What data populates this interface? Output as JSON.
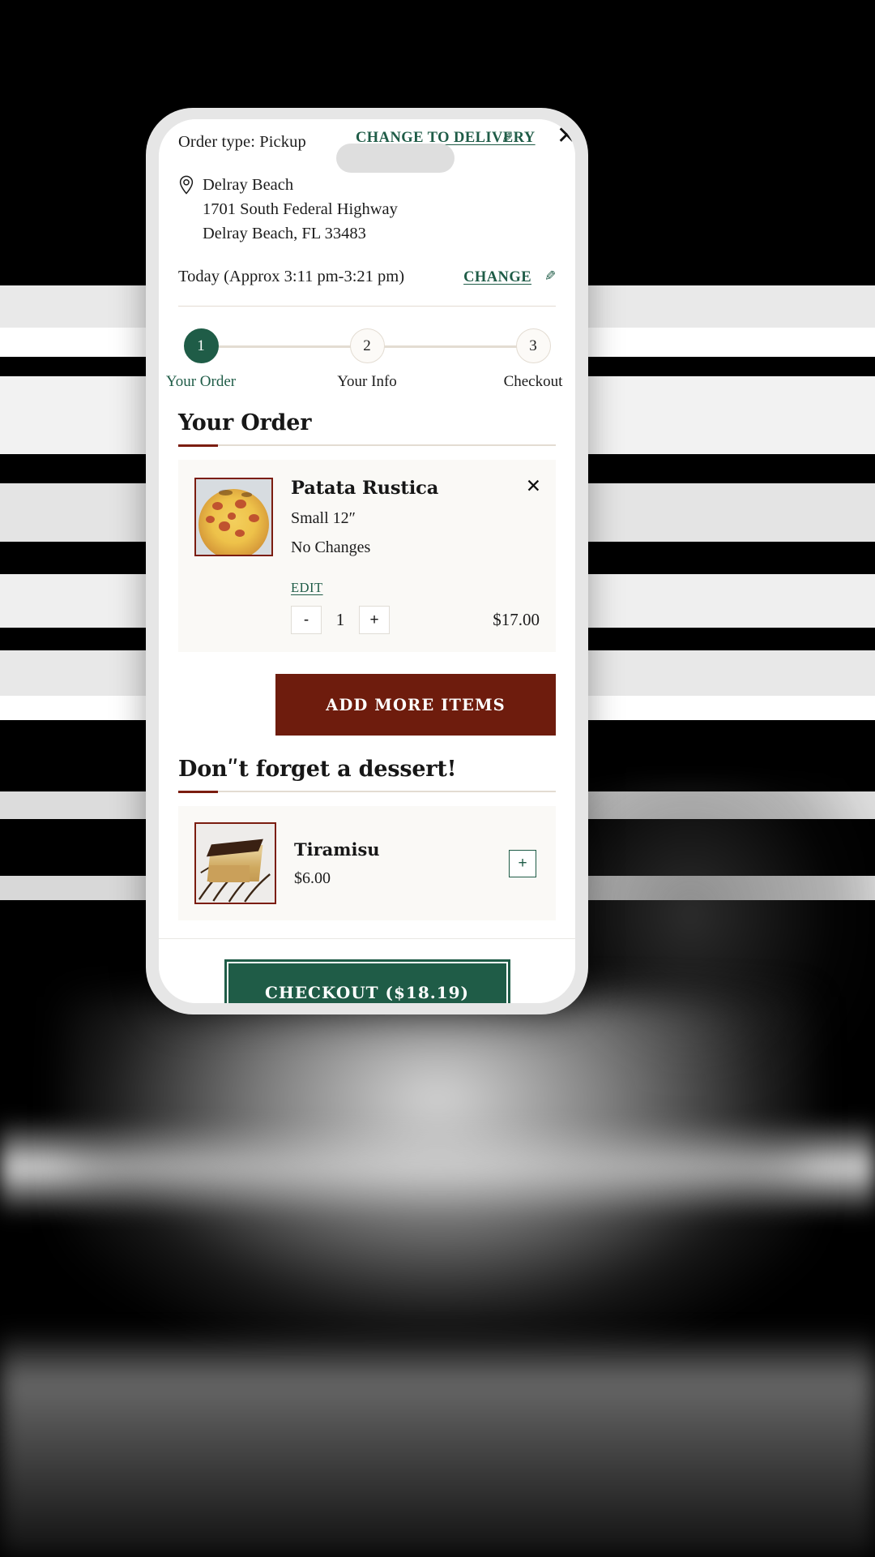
{
  "header": {
    "order_type_label": "Order type: Pickup",
    "change_to_delivery_label": "CHANGE TO DELIVERY",
    "pencil_glyph": "✎",
    "close_glyph": "✕"
  },
  "location": {
    "pin_icon": "map-pin-icon",
    "name": "Delray Beach",
    "street": "1701 South Federal Highway",
    "city_state_zip": "Delray Beach, FL 33483"
  },
  "time": {
    "text": "Today (Approx 3:11 pm-3:21 pm)",
    "change_label": "CHANGE",
    "pencil_glyph": "✎"
  },
  "stepper": {
    "steps": [
      {
        "number": "1",
        "label": "Your Order",
        "active": true
      },
      {
        "number": "2",
        "label": "Your Info",
        "active": false
      },
      {
        "number": "3",
        "label": "Checkout",
        "active": false
      }
    ]
  },
  "order_section": {
    "title": "Your Order",
    "item": {
      "name": "Patata Rustica",
      "size": "Small 12″",
      "changes": "No Changes",
      "edit_label": "EDIT",
      "remove_glyph": "✕",
      "qty_decrease": "-",
      "qty_value": "1",
      "qty_increase": "+",
      "price": "$17.00",
      "thumb_alt": "patata-rustica-pizza-image"
    },
    "add_more_label": "ADD MORE ITEMS"
  },
  "dessert_section": {
    "title": "Donʺt forget a dessert!",
    "item": {
      "name": "Tiramisu",
      "price": "$6.00",
      "add_glyph": "+",
      "thumb_alt": "tiramisu-dessert-image"
    }
  },
  "footer": {
    "checkout_label": "CHECKOUT ($18.19)"
  },
  "colors": {
    "brand_green": "#1f5c47",
    "brand_maroon": "#6e1c0d",
    "accent_rule": "#7b1d10",
    "card_bg": "#faf9f6",
    "hairline": "#e3dcd2"
  }
}
